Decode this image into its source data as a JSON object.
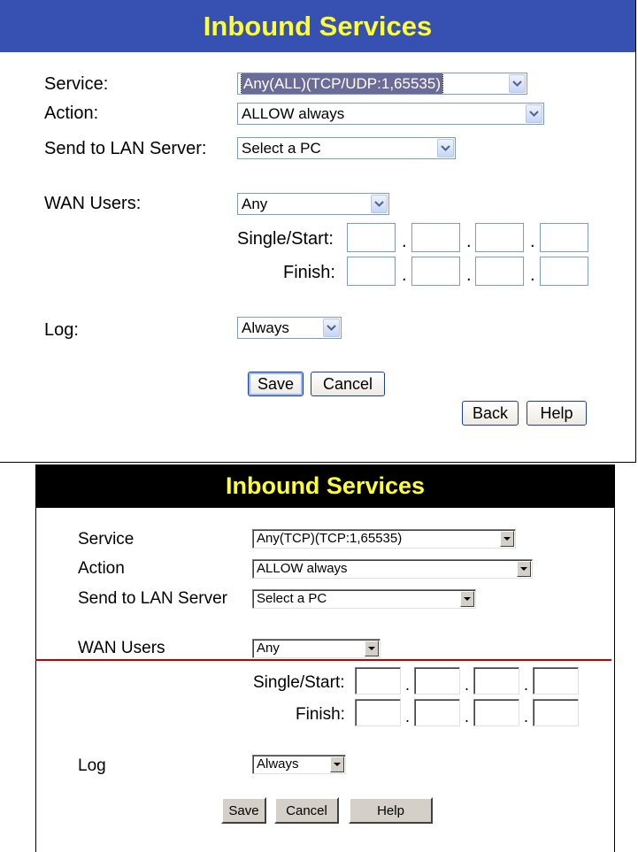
{
  "panel1": {
    "title": "Inbound Services",
    "labels": {
      "service": "Service:",
      "action": "Action:",
      "send_to_lan": "Send to LAN Server:",
      "wan_users": "WAN Users:",
      "single_start": "Single/Start:",
      "finish": "Finish:",
      "log": "Log:"
    },
    "selects": {
      "service": "Any(ALL)(TCP/UDP:1,65535)",
      "action": "ALLOW always",
      "send_to_lan": "Select a PC",
      "wan_users": "Any",
      "log": "Always"
    },
    "ip_separator": ".",
    "buttons": {
      "save": "Save",
      "cancel": "Cancel",
      "back": "Back",
      "help": "Help"
    }
  },
  "panel2": {
    "title": "Inbound Services",
    "labels": {
      "service": "Service",
      "action": "Action",
      "send_to_lan": "Send to LAN Server",
      "wan_users": "WAN Users",
      "single_start": "Single/Start:",
      "finish": "Finish:",
      "log": "Log"
    },
    "selects": {
      "service": "Any(TCP)(TCP:1,65535)",
      "action": "ALLOW always",
      "send_to_lan": "Select a PC",
      "wan_users": "Any",
      "log": "Always"
    },
    "ip_separator": ".",
    "buttons": {
      "save": "Save",
      "cancel": "Cancel",
      "help": "Help"
    }
  },
  "colors": {
    "panel1_header_bg": "#3651b1",
    "panel2_header_bg": "#000000",
    "header_text": "#ffff33",
    "divider_line": "#c00000"
  }
}
